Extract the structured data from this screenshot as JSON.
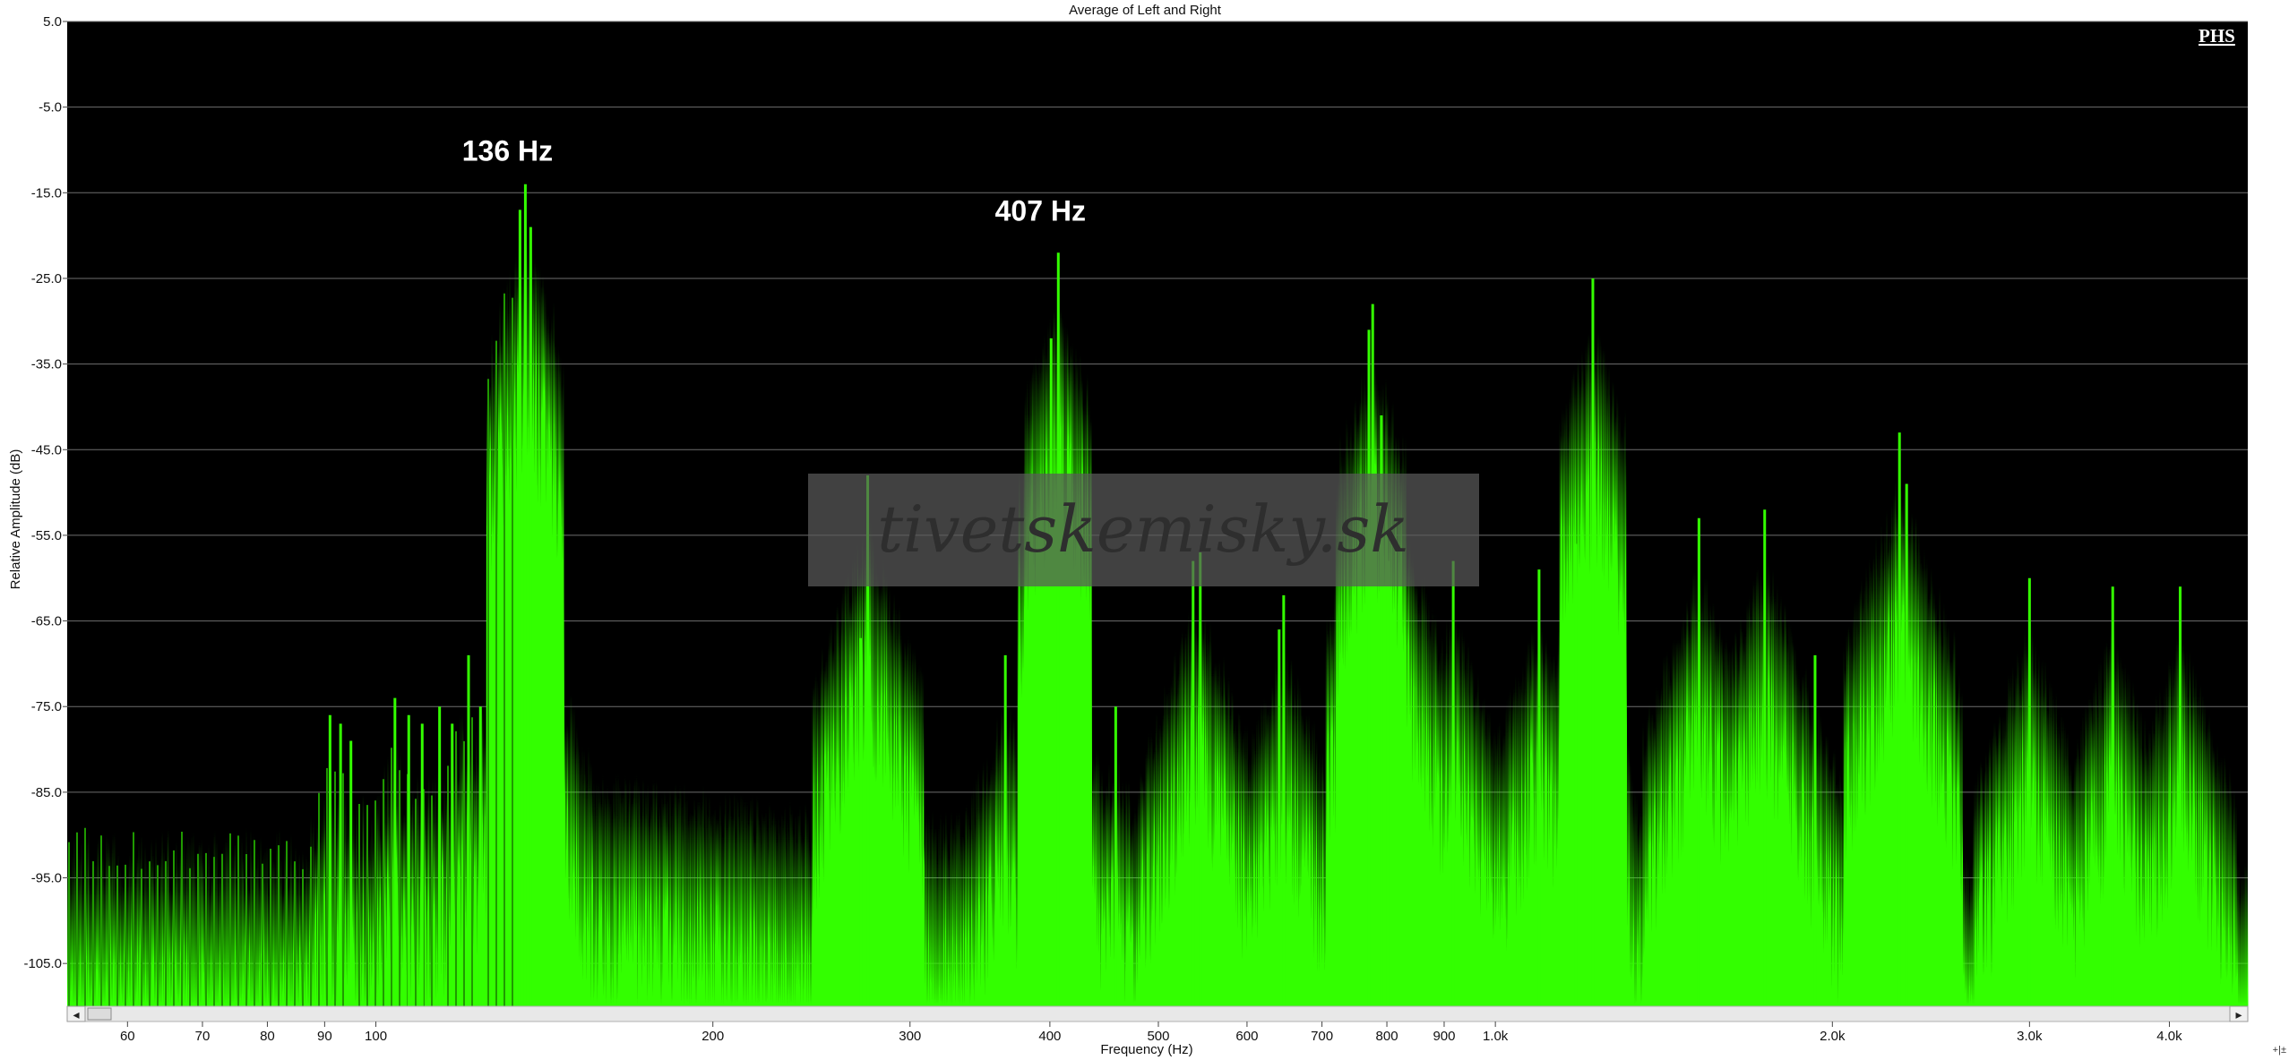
{
  "chart_data": {
    "type": "area",
    "title": "Average of Left and Right",
    "xlabel": "Frequency (Hz)",
    "ylabel": "Relative Amplitude (dB)",
    "x_scale": "log",
    "xlim": [
      53,
      4700
    ],
    "ylim": [
      -110,
      5
    ],
    "grid": "horizontal",
    "yticks": [
      5,
      -5,
      -15,
      -25,
      -35,
      -45,
      -55,
      -65,
      -75,
      -85,
      -95,
      -105
    ],
    "ytick_labels": [
      "5.0",
      "-5.0",
      "-15.0",
      "-25.0",
      "-35.0",
      "-45.0",
      "-55.0",
      "-65.0",
      "-75.0",
      "-85.0",
      "-95.0",
      "-105.0"
    ],
    "xticks": [
      60,
      70,
      80,
      90,
      100,
      200,
      300,
      400,
      500,
      600,
      700,
      800,
      900,
      1000,
      2000,
      3000,
      4000
    ],
    "xtick_labels": [
      "60",
      "70",
      "80",
      "90",
      "100",
      "200",
      "300",
      "400",
      "500",
      "600",
      "700",
      "800",
      "900",
      "1.0k",
      "2.0k",
      "3.0k",
      "4.0k"
    ],
    "colors": {
      "series": "#33ff00",
      "background": "#000000",
      "grid": "#6e6e6e"
    },
    "annotations": [
      {
        "text": "136 Hz",
        "x": 136,
        "y": -15
      },
      {
        "text": "407 Hz",
        "x": 407,
        "y": -22
      }
    ],
    "series": [
      {
        "peaks": [
          {
            "x": 91,
            "y": -76
          },
          {
            "x": 93,
            "y": -77
          },
          {
            "x": 95,
            "y": -79
          },
          {
            "x": 104,
            "y": -74
          },
          {
            "x": 107,
            "y": -76
          },
          {
            "x": 110,
            "y": -77
          },
          {
            "x": 114,
            "y": -75
          },
          {
            "x": 117,
            "y": -77
          },
          {
            "x": 121,
            "y": -69
          },
          {
            "x": 124,
            "y": -75
          },
          {
            "x": 134.5,
            "y": -17
          },
          {
            "x": 136,
            "y": -14
          },
          {
            "x": 137.5,
            "y": -19
          },
          {
            "x": 271,
            "y": -67
          },
          {
            "x": 275,
            "y": -48
          },
          {
            "x": 365,
            "y": -69
          },
          {
            "x": 401,
            "y": -32
          },
          {
            "x": 407,
            "y": -22
          },
          {
            "x": 458,
            "y": -75
          },
          {
            "x": 537,
            "y": -58
          },
          {
            "x": 545,
            "y": -57
          },
          {
            "x": 641,
            "y": -66
          },
          {
            "x": 647,
            "y": -62
          },
          {
            "x": 771,
            "y": -31
          },
          {
            "x": 777,
            "y": -28
          },
          {
            "x": 791,
            "y": -41
          },
          {
            "x": 802,
            "y": -58
          },
          {
            "x": 917,
            "y": -58
          },
          {
            "x": 1094,
            "y": -59
          },
          {
            "x": 1180,
            "y": -56
          },
          {
            "x": 1222,
            "y": -25
          },
          {
            "x": 1520,
            "y": -53
          },
          {
            "x": 1740,
            "y": -52
          },
          {
            "x": 1930,
            "y": -69
          },
          {
            "x": 2296,
            "y": -43
          },
          {
            "x": 2330,
            "y": -49
          },
          {
            "x": 3000,
            "y": -60
          },
          {
            "x": 3560,
            "y": -61
          },
          {
            "x": 4090,
            "y": -61
          }
        ]
      }
    ]
  },
  "watermark": {
    "text": "tivetskemisky.sk"
  },
  "logo": {
    "text": "PHS"
  },
  "scrollbar": {
    "left_arrow": "◂",
    "right_arrow": "▸"
  },
  "corner_controls": {
    "text": "+|±"
  }
}
